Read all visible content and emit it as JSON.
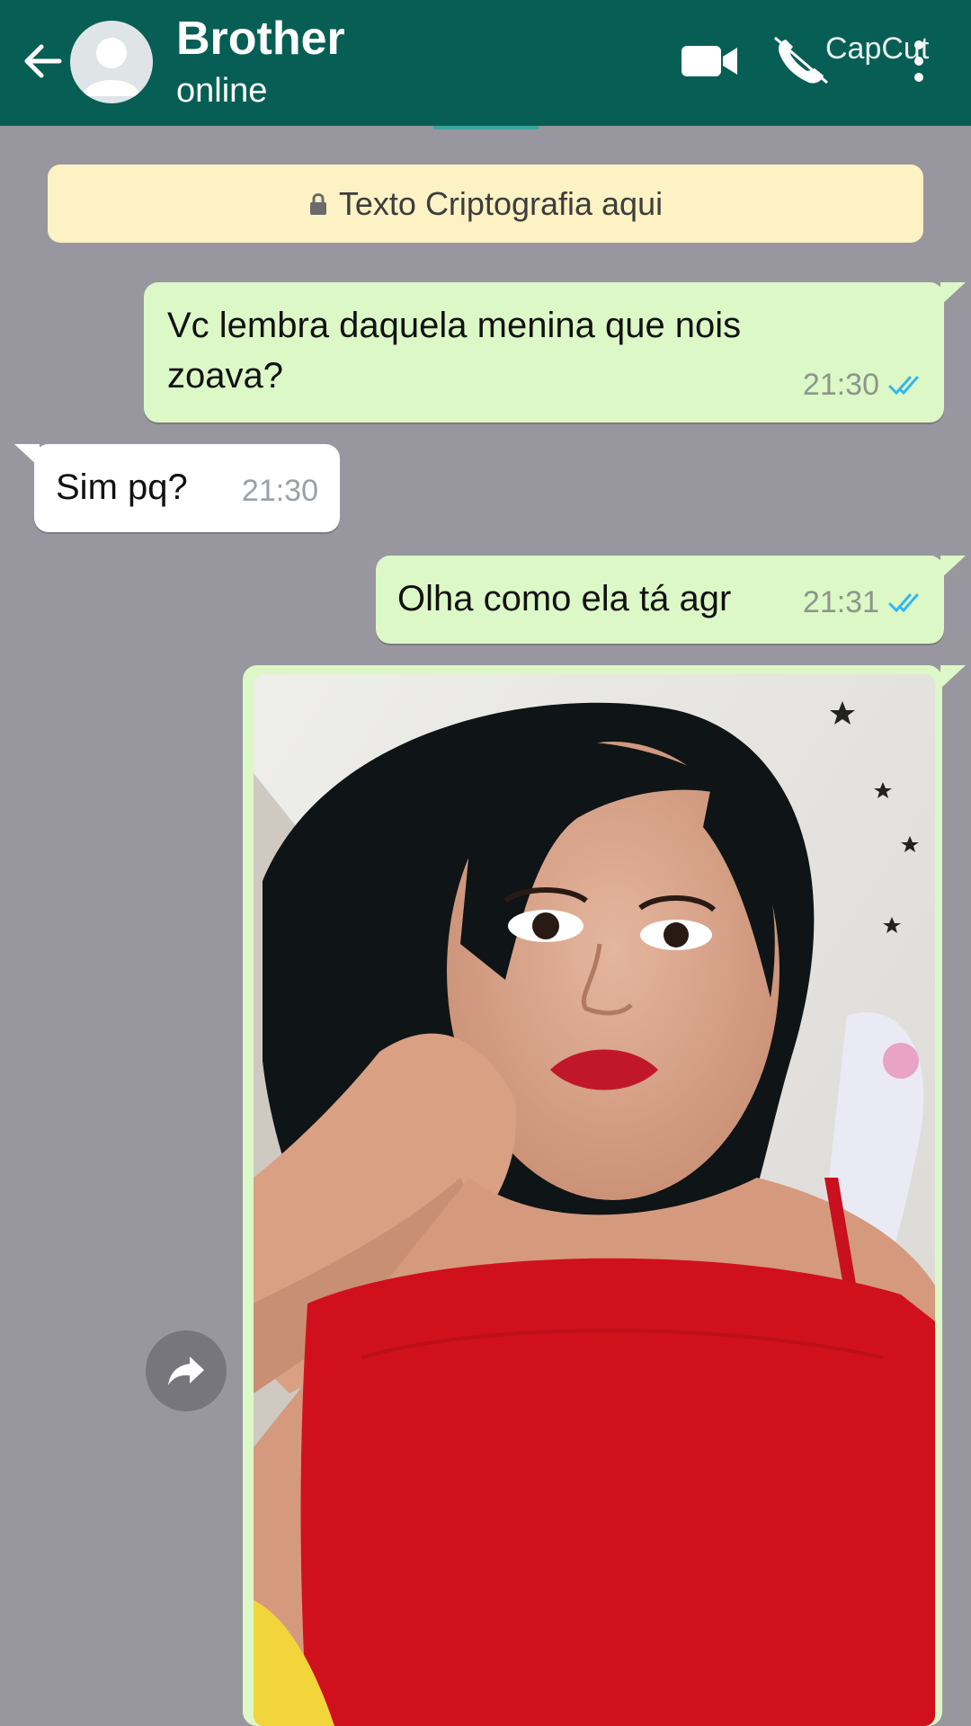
{
  "header": {
    "contact_name": "Brother",
    "status": "online",
    "watermark": "CapCut",
    "icons": [
      "back-arrow-icon",
      "avatar-placeholder-icon",
      "video-call-icon",
      "voice-call-icon",
      "more-options-icon"
    ]
  },
  "encryption_notice": {
    "icon": "lock-icon",
    "text": "Texto Criptografia aqui"
  },
  "messages": [
    {
      "direction": "outgoing",
      "text": "Vc lembra daquela menina que nois zoava?",
      "time": "21:30",
      "status": "read"
    },
    {
      "direction": "incoming",
      "text": "Sim pq?",
      "time": "21:30"
    },
    {
      "direction": "outgoing",
      "text": "Olha como ela tá agr",
      "time": "21:31",
      "status": "read"
    },
    {
      "direction": "outgoing",
      "type": "image",
      "description_icon": "photo-message"
    }
  ],
  "colors": {
    "header": "#075e54",
    "chat_background": "#98979f",
    "outgoing_bubble": "#dcf8c6",
    "incoming_bubble": "#ffffff",
    "encryption_banner": "#fdf2c4",
    "read_ticks": "#34b7f1"
  }
}
